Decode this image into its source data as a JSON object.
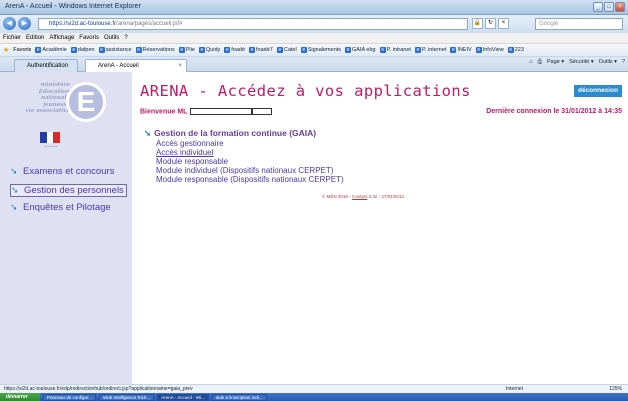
{
  "window": {
    "title": "ArenA - Accueil - Windows Internet Explorer"
  },
  "address": {
    "url_domain": "https://si2d.ac-toulouse.fr",
    "url_rest": "/arena/pages/accueil.jsf#",
    "search_placeholder": "Google"
  },
  "menu": [
    "Fichier",
    "Edition",
    "Affichage",
    "Favoris",
    "Outils",
    "?"
  ],
  "favorites": {
    "label": "Favoris",
    "items": [
      "Académie",
      "dafpen",
      "assistance",
      "Réservations",
      "Plie",
      "Quidy",
      "foadé",
      "foadé7",
      "Catel",
      "Signalements",
      "GAIA ebg",
      "P. intranet",
      "P. internet",
      "INEIV",
      "InfoView",
      "223"
    ]
  },
  "tabs": [
    {
      "label": "Authentification"
    },
    {
      "label": "ArenA - Accueil",
      "close": "×"
    }
  ],
  "commandbar": [
    "Page ▾",
    "Sécurité ▾",
    "Outils ▾"
  ],
  "logo": {
    "words": [
      "ministère",
      "Éducation",
      "nationale",
      "jeunesse",
      "vie associative"
    ],
    "letter": "E"
  },
  "sidebar": {
    "items": [
      {
        "label": "Examens et concours"
      },
      {
        "label": "Gestion des personnels"
      },
      {
        "label": "Enquêtes et Pilotage"
      }
    ]
  },
  "main": {
    "title": "ARENA - Accédez à vos applications",
    "logout": "déconnexion",
    "welcome": "Bienvenue ML",
    "last_login": "Dernière connexion le 31/01/2012 à 14:35",
    "section": "Gestion de la formation continue (GAIA)",
    "links": [
      {
        "label": "Accès gestionnaire"
      },
      {
        "label": "Accès individuel"
      },
      {
        "label": "Module responsable"
      },
      {
        "label": "Module individuel (Dispositifs nationaux CERPET)"
      },
      {
        "label": "Module responsable (Dispositifs nationaux CERPET)"
      }
    ],
    "footer": {
      "prefix": "© MEN 2010 - ",
      "contact": "Contact",
      "suffix": " 3.3e - 27/04/2012"
    }
  },
  "status": {
    "url": "https://si2d.ac-toulouse.fr/edp/redirectionhub/redirect.jsp?applicationname=gaia_prev",
    "zone": "Internet",
    "zoom": "125%"
  },
  "taskbar": {
    "start": "démarrer",
    "tasks": [
      "Panneau de configur...",
      "Web Intelligence Rich...",
      "ArenA - Accueil - Wi...",
      "aide a linscription indi..."
    ]
  },
  "colors": {
    "accent": "#c21869",
    "link": "#4a3aa6",
    "sidebar_bg": "#dfe1f2",
    "logout_bg": "#2a8bd0"
  }
}
